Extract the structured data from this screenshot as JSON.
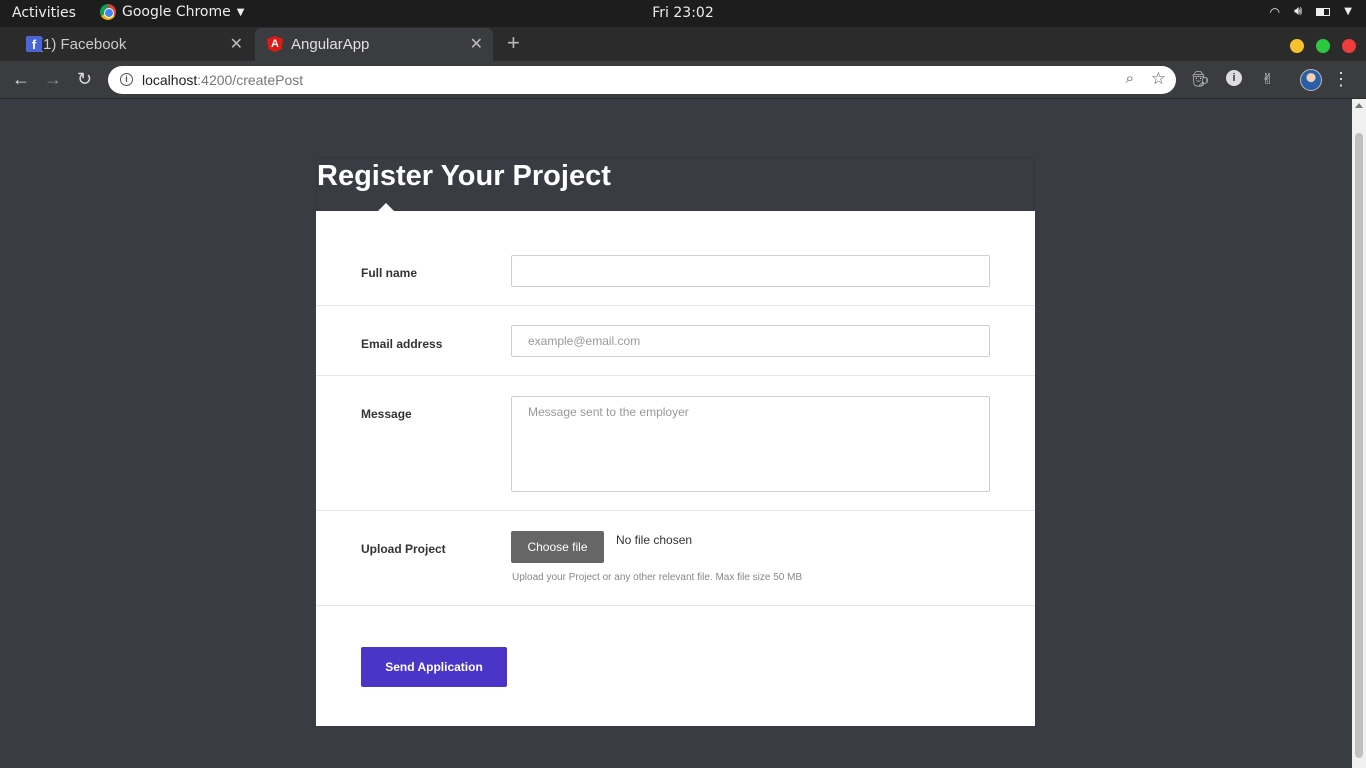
{
  "topbar": {
    "activities": "Activities",
    "app_name": "Google Chrome",
    "clock": "Fri 23:02"
  },
  "tabs": [
    {
      "title": "(1) Facebook",
      "favicon": "facebook-icon",
      "active": false
    },
    {
      "title": "AngularApp",
      "favicon": "angular-icon",
      "active": true
    }
  ],
  "toolbar": {
    "url_host": "localhost",
    "url_path": ":4200/createPost"
  },
  "page": {
    "title": "Register Your Project"
  },
  "form": {
    "full_name": {
      "label": "Full name",
      "value": "",
      "placeholder": ""
    },
    "email": {
      "label": "Email address",
      "value": "",
      "placeholder": "example@email.com"
    },
    "message": {
      "label": "Message",
      "value": "",
      "placeholder": "Message sent to the employer"
    },
    "upload": {
      "label": "Upload Project",
      "button_label": "Choose file",
      "file_status": "No file chosen",
      "help": "Upload your Project or any other relevant file. Max file size 50 MB"
    },
    "submit_label": "Send Application"
  },
  "colors": {
    "page_background": "#393c43",
    "submit_button": "#4b35c9",
    "window_minimize": "#f6c12c",
    "window_maximize": "#2bc840",
    "window_close": "#ee3b3b"
  }
}
